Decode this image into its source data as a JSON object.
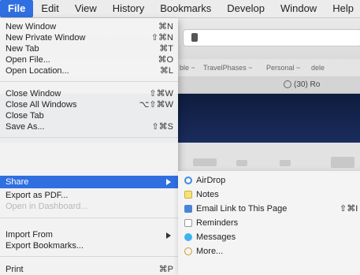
{
  "menubar": {
    "items": [
      "File",
      "Edit",
      "View",
      "History",
      "Bookmarks",
      "Develop",
      "Window",
      "Help"
    ]
  },
  "browser": {
    "favorites": [
      "ble ~",
      "TravelPhases ~",
      "Personal ~",
      "dele"
    ],
    "tab_title": "(30) Ro"
  },
  "file_menu": {
    "items": [
      {
        "label": "New Window",
        "shortcut": "⌘N"
      },
      {
        "label": "New Private Window",
        "shortcut": "⇧⌘N"
      },
      {
        "label": "New Tab",
        "shortcut": "⌘T"
      },
      {
        "label": "Open File...",
        "shortcut": "⌘O"
      },
      {
        "label": "Open Location...",
        "shortcut": "⌘L"
      },
      {
        "label": "Close Window",
        "shortcut": "⇧⌘W"
      },
      {
        "label": "Close All Windows",
        "shortcut": "⌥⇧⌘W"
      },
      {
        "label": "Close Tab",
        "shortcut": ""
      },
      {
        "label": "Save As...",
        "shortcut": "⇧⌘S"
      },
      {
        "label": "Share",
        "shortcut": ""
      },
      {
        "label": "Export as PDF...",
        "shortcut": ""
      },
      {
        "label": "Open in Dashboard...",
        "shortcut": ""
      },
      {
        "label": "Import From",
        "shortcut": ""
      },
      {
        "label": "Export Bookmarks...",
        "shortcut": ""
      },
      {
        "label": "Print",
        "shortcut": "⌘P"
      }
    ]
  },
  "share_menu": {
    "items": [
      {
        "label": "AirDrop",
        "shortcut": ""
      },
      {
        "label": "Notes",
        "shortcut": ""
      },
      {
        "label": "Email Link to This Page",
        "shortcut": "⇧⌘I"
      },
      {
        "label": "Reminders",
        "shortcut": ""
      },
      {
        "label": "Messages",
        "shortcut": ""
      },
      {
        "label": "More...",
        "shortcut": ""
      }
    ]
  },
  "colors": {
    "highlight": "#2f6fe0",
    "nav_band": "#12224a"
  }
}
